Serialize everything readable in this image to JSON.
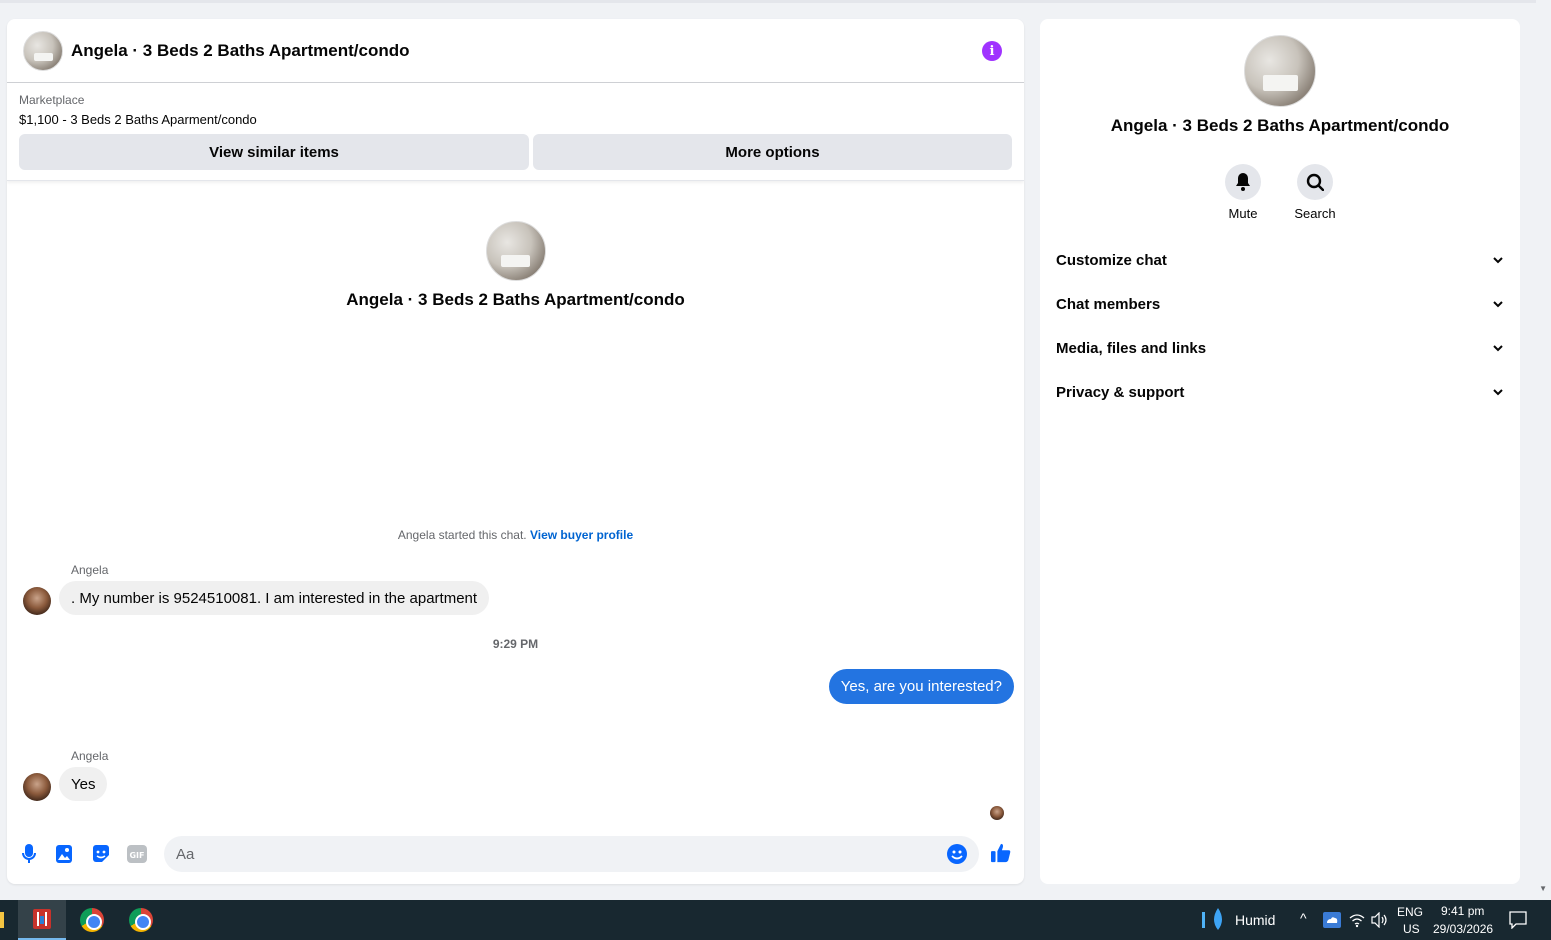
{
  "chat": {
    "title": "Angela · 3 Beds 2 Baths Apartment/condo",
    "marketplace_label": "Marketplace",
    "listing": "$1,100 - 3 Beds 2 Baths Aparment/condo",
    "view_similar_label": "View similar items",
    "more_options_label": "More options",
    "intro_title": "Angela · 3 Beds 2 Baths Apartment/condo",
    "started_text": "Angela started this chat.",
    "buyer_profile_link": "View buyer profile",
    "messages": [
      {
        "sender": "Angela",
        "text": ". My number is 9524510081. I am interested in the apartment"
      },
      {
        "timestamp": "9:29 PM"
      },
      {
        "sender": "me",
        "text": "Yes, are you interested?"
      },
      {
        "sender": "Angela",
        "text": "Yes"
      }
    ],
    "composer_placeholder": "Aa",
    "accent_color": "#2374e1"
  },
  "side": {
    "title": "Angela · 3 Beds 2 Baths Apartment/condo",
    "mute_label": "Mute",
    "search_label": "Search",
    "sections": [
      "Customize chat",
      "Chat members",
      "Media, files and links",
      "Privacy & support"
    ]
  },
  "taskbar": {
    "weather": "Humid",
    "lang_top": "ENG",
    "lang_bottom": "US",
    "time": "9:41 pm",
    "date": "29/03/2026"
  }
}
